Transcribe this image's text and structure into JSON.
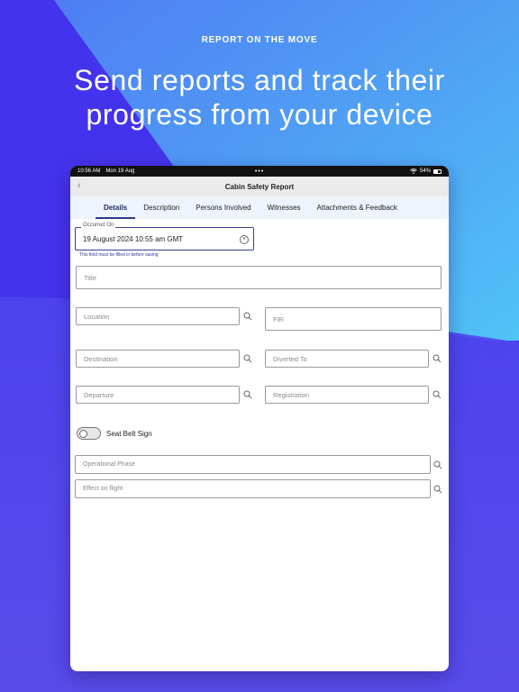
{
  "promo": {
    "kicker": "REPORT ON THE MOVE",
    "headline_line1": "Send reports and track their",
    "headline_line2": "progress from your device"
  },
  "statusbar": {
    "time": "10:56 AM",
    "date": "Mon 19 Aug",
    "battery": "54%"
  },
  "navbar": {
    "title": "Cabin Safety Report"
  },
  "tabs": [
    {
      "label": "Details",
      "active": true
    },
    {
      "label": "Description",
      "active": false
    },
    {
      "label": "Persons Involved",
      "active": false
    },
    {
      "label": "Witnesses",
      "active": false
    },
    {
      "label": "Attachments & Feedback",
      "active": false
    }
  ],
  "form": {
    "occurred_on": {
      "label": "Occurred On",
      "value": "19 August 2024 10:55 am GMT",
      "hint": "This field must be filled in before saving"
    },
    "title_placeholder": "Title",
    "location_placeholder": "Location",
    "fir_placeholder": "FIR",
    "destination_placeholder": "Destination",
    "diverted_to_placeholder": "Diverted To",
    "departure_placeholder": "Departure",
    "registration_placeholder": "Registration",
    "seat_belt_label": "Seat Belt Sign",
    "seat_belt_on": false,
    "operational_phase_placeholder": "Operational Phase",
    "effect_on_flight_placeholder": "Effect on flight"
  },
  "colors": {
    "accent": "#2b3a8c",
    "bg_blue": "#4a3ff0",
    "bg_cyan": "#4fb6f4"
  }
}
